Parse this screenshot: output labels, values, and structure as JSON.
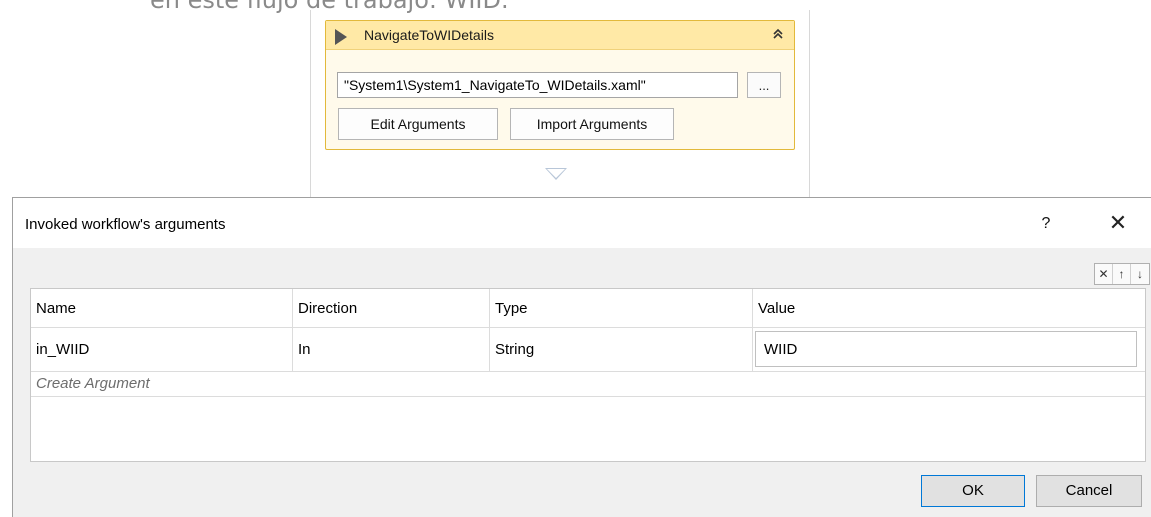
{
  "background": {
    "caption": "en este flujo de trabajo: WIID."
  },
  "activity": {
    "title": "NavigateToWIDetails",
    "file_path": "\"System1\\System1_NavigateTo_WIDetails.xaml\"",
    "browse_label": "...",
    "edit_arguments_label": "Edit Arguments",
    "import_arguments_label": "Import Arguments"
  },
  "dialog": {
    "title": "Invoked workflow's arguments",
    "help_label": "?",
    "close_label": "✕",
    "toolbar": {
      "delete_label": "✕",
      "up_label": "↑",
      "down_label": "↓"
    },
    "columns": {
      "name": "Name",
      "direction": "Direction",
      "type": "Type",
      "value": "Value"
    },
    "rows": [
      {
        "name": "in_WIID",
        "direction": "In",
        "type": "String",
        "value": "WIID"
      }
    ],
    "create_argument_label": "Create Argument",
    "ok_label": "OK",
    "cancel_label": "Cancel"
  },
  "colors": {
    "activity_header": "#ffe9a6",
    "activity_border": "#e2b93b",
    "dialog_background": "#f0f0f0",
    "ok_border": "#0078d7"
  },
  "icons": {
    "activity_icon": "play-icon",
    "collapse_icon": "double-chevron-up-icon",
    "drop_icon": "chevron-down-icon"
  }
}
